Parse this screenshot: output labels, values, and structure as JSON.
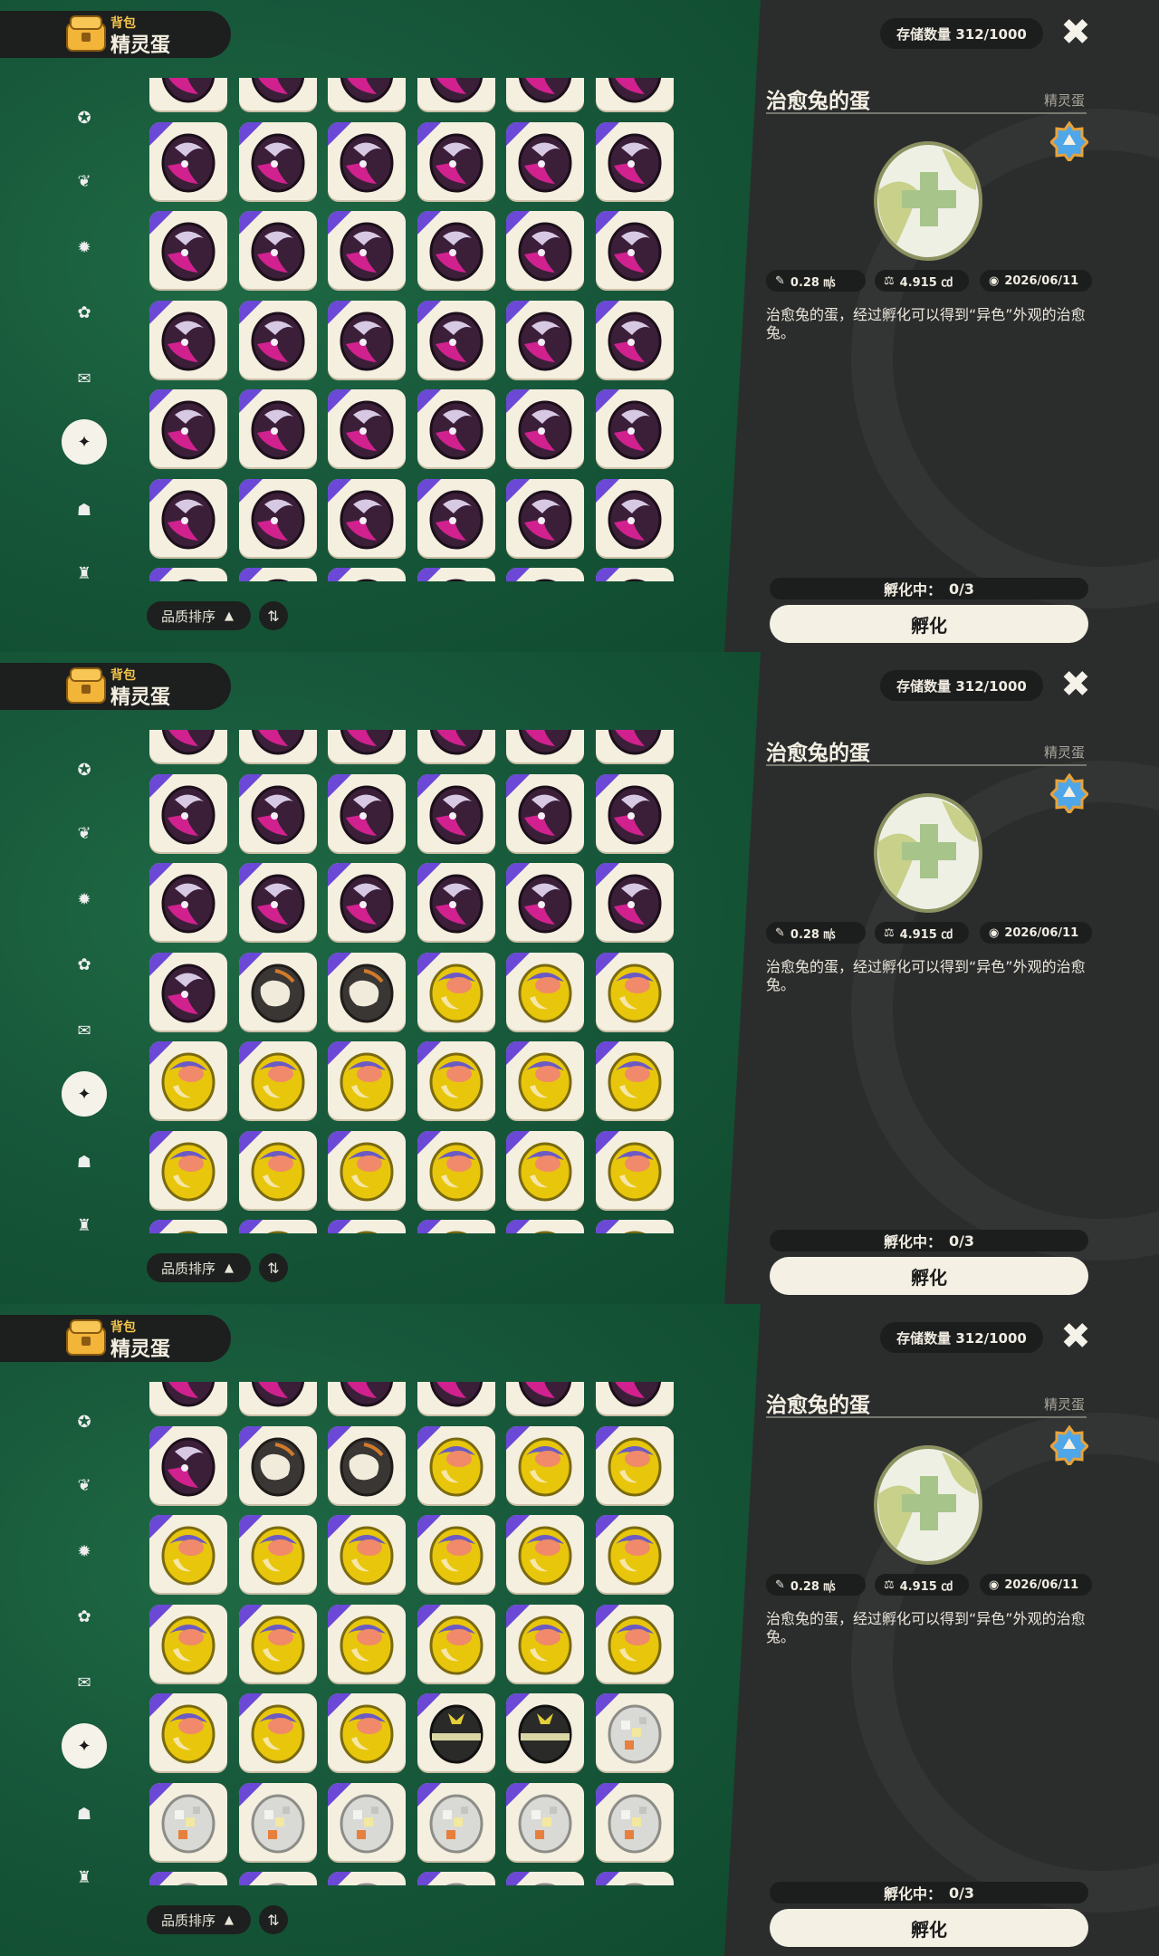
{
  "header": {
    "subtitle": "背包",
    "title": "精灵蛋"
  },
  "sidebar": {
    "items": [
      {
        "icon": "star-badge-icon"
      },
      {
        "icon": "leaf-icon"
      },
      {
        "icon": "burst-star-icon"
      },
      {
        "icon": "leaf-star-icon"
      },
      {
        "icon": "scroll-icon"
      },
      {
        "icon": "egg-stars-icon",
        "active": true
      },
      {
        "icon": "acorn-icon"
      },
      {
        "icon": "armchair-icon"
      }
    ]
  },
  "sort": {
    "label": "品质排序",
    "direction_icon": "▲",
    "toggle_icon": "⇅"
  },
  "storage": {
    "label": "存储数量 312/1000"
  },
  "close_icon": "✖",
  "item": {
    "name": "治愈兔的蛋",
    "type": "精灵蛋",
    "size": "0.28 ㎧",
    "weight": "4.915 ㏅",
    "date": "2026/06/11",
    "description": "治愈兔的蛋，经过孵化可以得到“异色”外观的治愈兔。",
    "incubating_label": "孵化中：",
    "incubating_value": "0/3",
    "hatch_button": "孵化"
  },
  "colors": {
    "green_bg": "#17573a",
    "dark_panel": "#2b2d2c",
    "cell_bg": "#f5efdf",
    "corner_purple": "#6b48d6",
    "egg_purple": "#3b1f38",
    "egg_magenta": "#d0218f",
    "egg_yellow": "#e8c60b",
    "egg_black": "#2a2a28",
    "egg_silver": "#d9d9d6"
  },
  "panels": [
    {
      "rows": [
        [
          "purple",
          "purple",
          "purple",
          "purple",
          "purple",
          "purple"
        ],
        [
          "purple",
          "purple",
          "purple",
          "purple",
          "purple",
          "purple"
        ],
        [
          "purple",
          "purple",
          "purple",
          "purple",
          "purple",
          "purple"
        ],
        [
          "purple",
          "purple",
          "purple",
          "purple",
          "purple",
          "purple"
        ],
        [
          "purple",
          "purple",
          "purple",
          "purple",
          "purple",
          "purple"
        ],
        [
          "purple",
          "purple",
          "purple",
          "purple",
          "purple",
          "purple"
        ],
        [
          "purple",
          "purple",
          "purple",
          "purple",
          "purple",
          "purple"
        ]
      ]
    },
    {
      "rows": [
        [
          "purple",
          "purple",
          "purple",
          "purple",
          "purple",
          "purple"
        ],
        [
          "purple",
          "purple",
          "purple",
          "purple",
          "purple",
          "purple"
        ],
        [
          "purple",
          "purple",
          "purple",
          "purple",
          "purple",
          "purple"
        ],
        [
          "purple",
          "cream",
          "cream",
          "yellow",
          "yellow",
          "yellow"
        ],
        [
          "yellow",
          "yellow",
          "yellow",
          "yellow",
          "yellow",
          "yellow"
        ],
        [
          "yellow",
          "yellow",
          "yellow",
          "yellow",
          "yellow",
          "yellow"
        ],
        [
          "yellow",
          "yellow",
          "yellow",
          "yellow",
          "yellow",
          "yellow"
        ]
      ]
    },
    {
      "rows": [
        [
          "purple",
          "purple",
          "purple",
          "purple",
          "purple",
          "purple"
        ],
        [
          "purple",
          "cream",
          "cream",
          "yellow",
          "yellow",
          "yellow"
        ],
        [
          "yellow",
          "yellow",
          "yellow",
          "yellow",
          "yellow",
          "yellow"
        ],
        [
          "yellow",
          "yellow",
          "yellow",
          "yellow",
          "yellow",
          "yellow"
        ],
        [
          "yellow",
          "yellow",
          "yellow",
          "black",
          "black",
          "silver"
        ],
        [
          "silver",
          "silver",
          "silver",
          "silver",
          "silver",
          "silver"
        ],
        [
          "silver",
          "silver",
          "silver",
          "silver",
          "silver",
          "silver"
        ]
      ]
    }
  ]
}
